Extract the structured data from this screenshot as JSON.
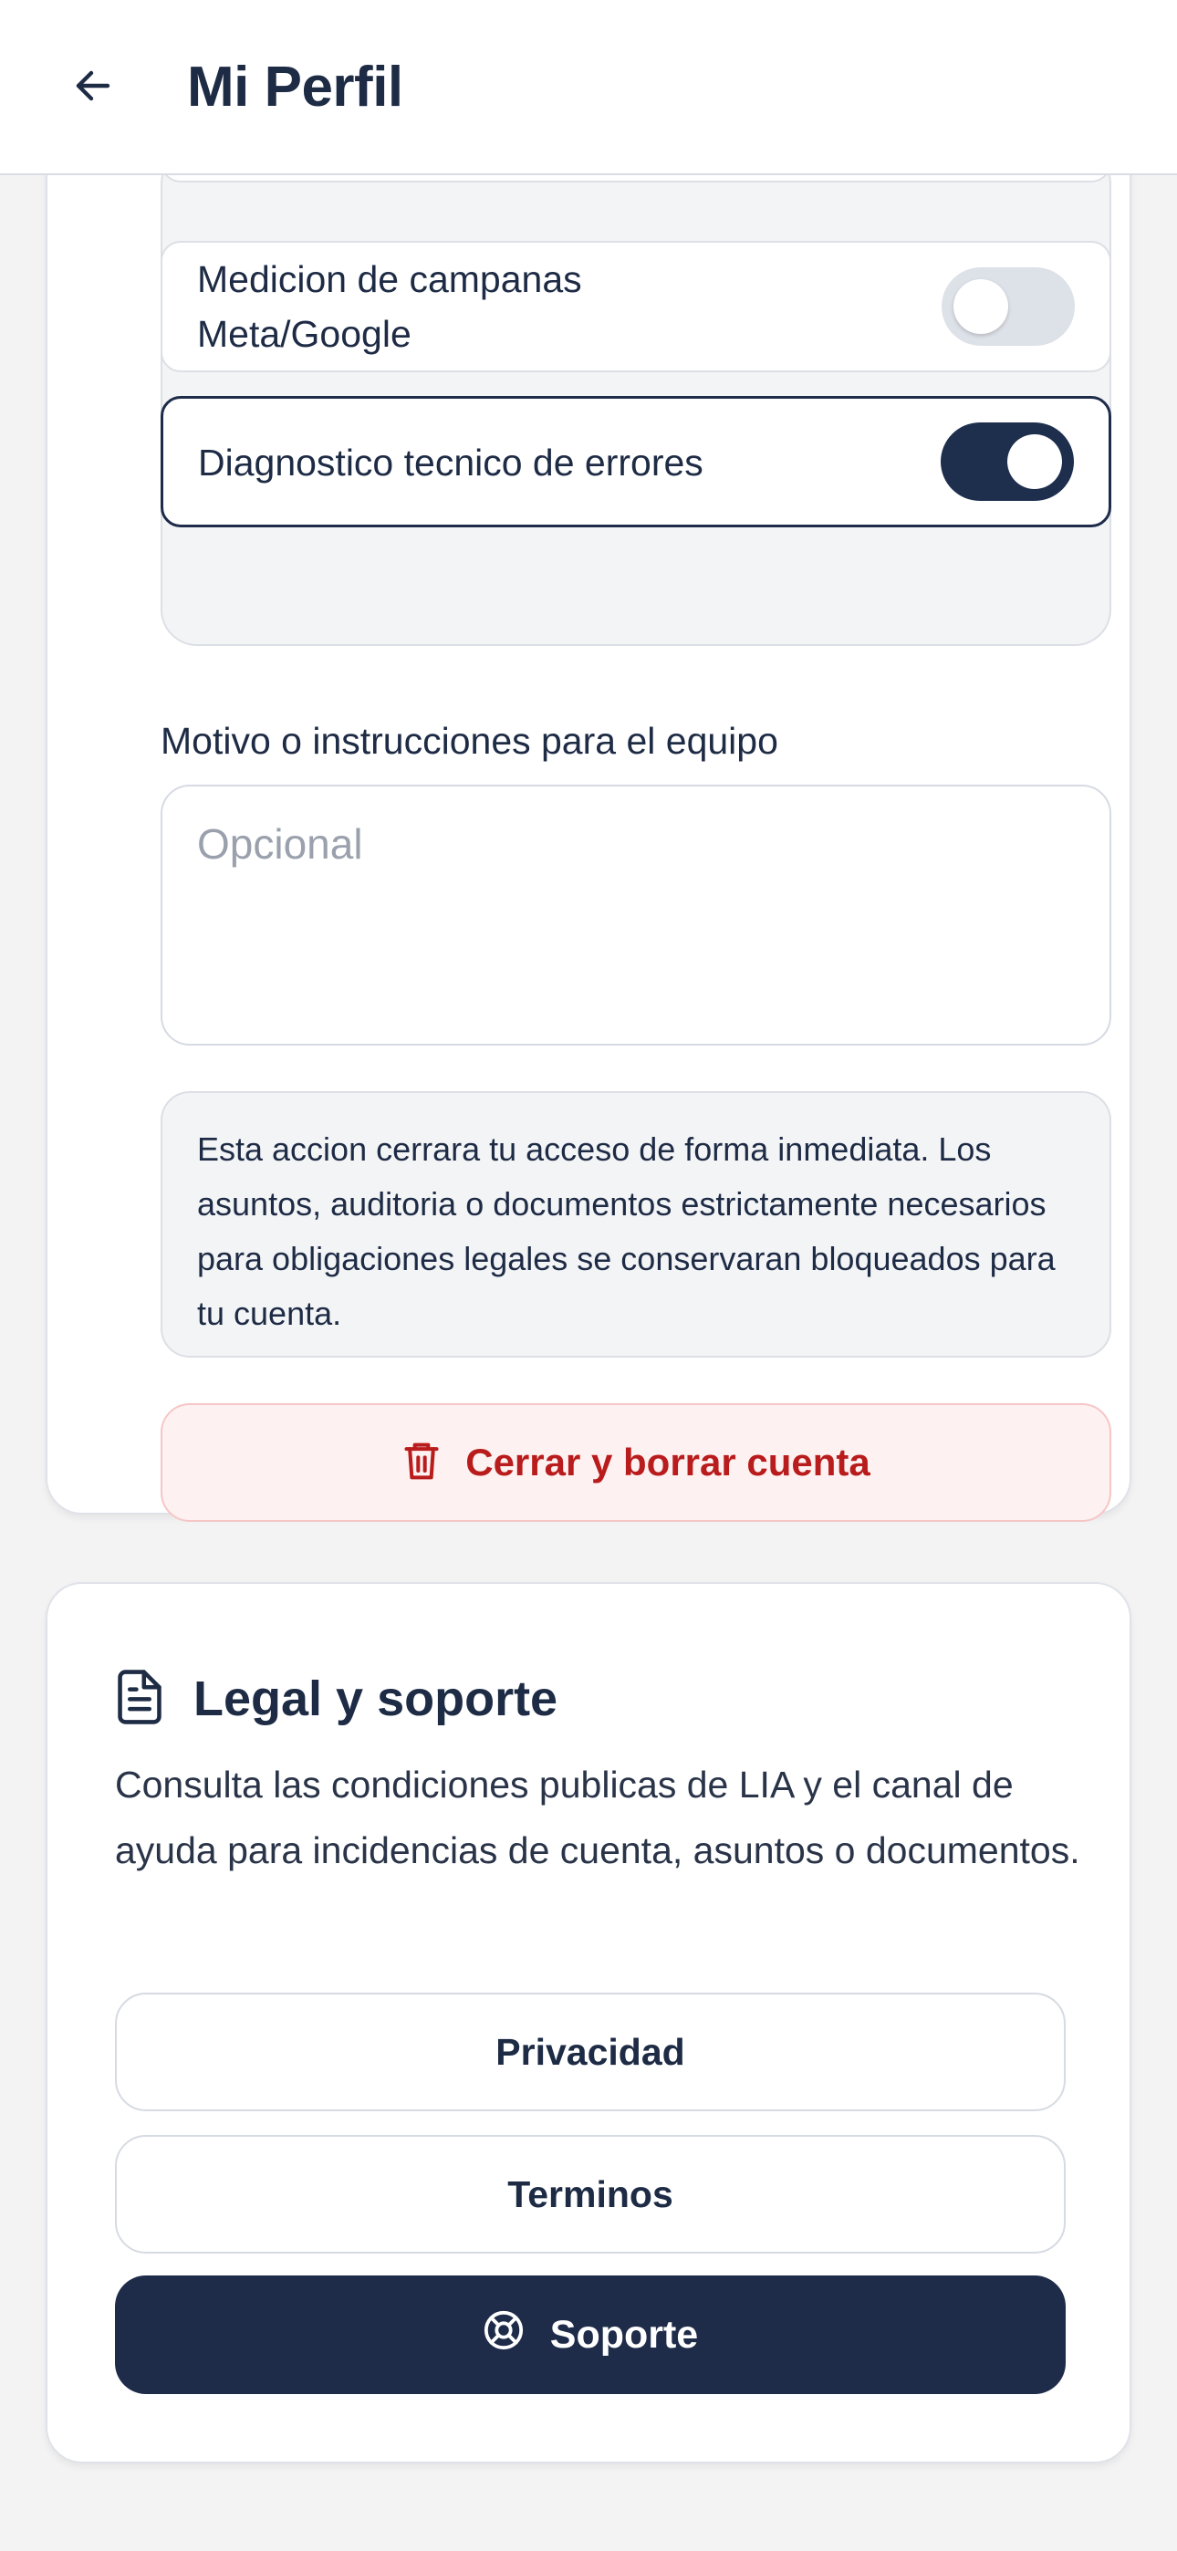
{
  "header": {
    "title": "Mi Perfil",
    "back_icon": "arrow-left-icon"
  },
  "consent": {
    "items": [
      {
        "label": "",
        "enabled": false
      },
      {
        "label": "Medicion de campanas Meta/Google",
        "enabled": false
      },
      {
        "label": "Diagnostico tecnico de errores",
        "enabled": true
      }
    ]
  },
  "delete_account": {
    "reason_label": "Motivo o instrucciones para el equipo",
    "reason_placeholder": "Opcional",
    "reason_value": "",
    "warning": "Esta accion cerrara tu acceso de forma inmediata. Los asuntos, auditoria o documentos estrictamente necesarios para obligaciones legales se conservaran bloqueados para tu cuenta.",
    "button_label": "Cerrar y borrar cuenta",
    "button_icon": "trash-icon"
  },
  "legal": {
    "icon": "document-icon",
    "title": "Legal y soporte",
    "description": "Consulta las condiciones publicas de LIA y el canal de ayuda para incidencias de cuenta, asuntos o documentos.",
    "privacy_label": "Privacidad",
    "terms_label": "Terminos",
    "support_label": "Soporte",
    "support_icon": "lifebuoy-icon"
  },
  "colors": {
    "primary": "#1e2c4a",
    "danger": "#b91c1c",
    "danger_bg": "#fef1f1",
    "muted_bg": "#f3f4f6"
  }
}
